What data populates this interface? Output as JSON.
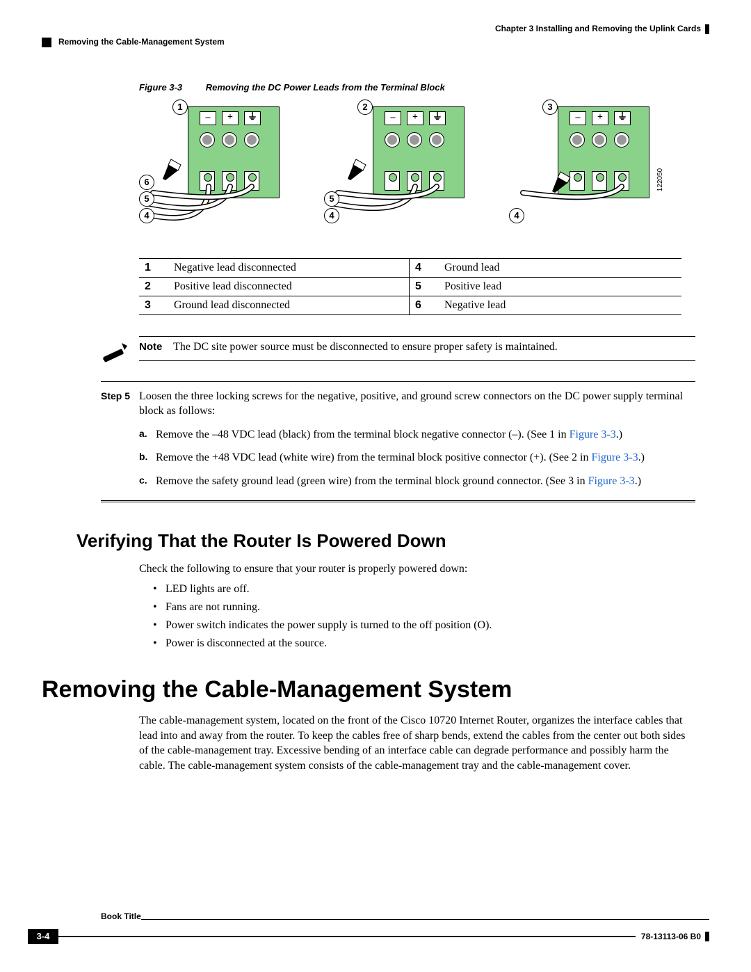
{
  "header": {
    "chapter": "Chapter 3      Installing and Removing the Uplink Cards",
    "section": "Removing the Cable-Management System"
  },
  "figure": {
    "label": "Figure 3-3",
    "caption": "Removing the DC Power Leads from the Terminal Block",
    "drawing_number": "122050",
    "modules": {
      "m1": {
        "top": "1",
        "leads": [
          "6",
          "5",
          "4"
        ]
      },
      "m2": {
        "top": "2",
        "leads": [
          "5",
          "4"
        ]
      },
      "m3": {
        "top": "3",
        "leads": [
          "4"
        ]
      }
    },
    "key": [
      {
        "n1": "1",
        "t1": "Negative lead disconnected",
        "n2": "4",
        "t2": "Ground lead"
      },
      {
        "n1": "2",
        "t1": "Positive lead disconnected",
        "n2": "5",
        "t2": "Positive lead"
      },
      {
        "n1": "3",
        "t1": "Ground lead disconnected",
        "n2": "6",
        "t2": "Negative lead"
      }
    ]
  },
  "note": {
    "label": "Note",
    "text": "The DC site power source must be disconnected to ensure proper safety is maintained."
  },
  "step": {
    "label": "Step 5",
    "intro": "Loosen the three locking screws for the negative, positive, and ground screw connectors on the DC power supply terminal block as follows:",
    "items": {
      "a": {
        "m": "a.",
        "pre": "Remove the –48 VDC lead (black) from the terminal block negative connector (–). (See 1 in ",
        "link": "Figure 3-3",
        "post": ".)"
      },
      "b": {
        "m": "b.",
        "pre": "Remove the +48 VDC lead (white wire) from the terminal block positive connector (+). (See 2 in ",
        "link": "Figure 3-3",
        "post": ".)"
      },
      "c": {
        "m": "c.",
        "pre": "Remove the safety ground lead (green wire) from the terminal block ground connector. (See 3 in ",
        "link": "Figure 3-3",
        "post": ".)"
      }
    }
  },
  "h2": "Verifying That the Router Is Powered Down",
  "verify_intro": "Check the following to ensure that your router is properly powered down:",
  "verify_list": [
    "LED lights are off.",
    "Fans are not running.",
    "Power switch indicates the power supply is turned to the off position (O).",
    "Power is disconnected at the source."
  ],
  "h1": "Removing the Cable-Management System",
  "main_para": "The cable-management system, located on the front of the Cisco 10720 Internet Router, organizes the interface cables that lead into and away from the router. To keep the cables free of sharp bends, extend the cables from the center out both sides of the cable-management tray. Excessive bending of an interface cable can degrade performance and possibly harm the cable. The cable-management system consists of the cable-management tray and the cable-management cover.",
  "footer": {
    "book": "Book Title",
    "page": "3-4",
    "doc": "78-13113-06 B0"
  }
}
